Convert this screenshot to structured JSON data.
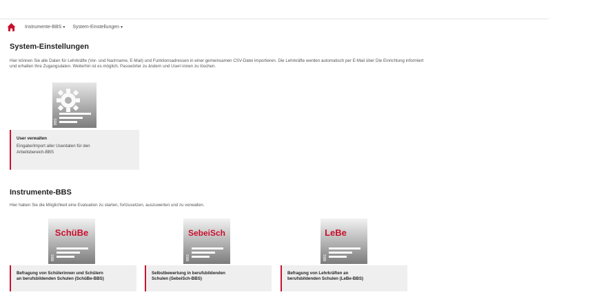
{
  "nav": {
    "items": [
      {
        "label": "Instrumente-BBS"
      },
      {
        "label": "System-Einstellungen"
      }
    ]
  },
  "colors": {
    "accent": "#c8102e",
    "card_bg": "#efefef"
  },
  "system": {
    "heading": "System-Einstellungen",
    "desc_line1": "Hier können Sie alle Daten für Lehrkräfte (Vor- und Nachname, E-Mail) und Funktionsadressen in einer gemeinsamen CSV-Datei importieren. Die Lehrkräfte werden automatisch per E-Mail über Die Einrichtung informiert",
    "desc_line2": "und erhalten Ihre Zugangsdaten. Weiterhin ist es möglich, Passwörter zu ändern und User/-innen zu löschen.",
    "card": {
      "icon_text": "BBS",
      "title": "User verwalten",
      "sub_line1": "Eingabe/Import aller Userdaten für den",
      "sub_line2": "Arbeitsbereich-BBS"
    }
  },
  "instruments": {
    "heading": "Instrumente-BBS",
    "desc": "Hier haben Sie die Möglichkeit eine Evaluation zu starten, fortzusetzen, auszuwerten und zu verwalten.",
    "cards": [
      {
        "logo": "SchüBe",
        "side": "BBS",
        "line1": "Befragung von Schülerinnen und Schülern",
        "line2": "an berufsbildenden Schulen (SchüBe-BBS)"
      },
      {
        "logo": "SebeiSch",
        "side": "BBS",
        "line1": "Selbstbewertung in berufsbildenden",
        "line2": "Schulen (SebeiSch-BBS)"
      },
      {
        "logo": "LeBe",
        "side": "BBS",
        "line1": "Befragung von Lehrkräften an",
        "line2": "berufsbildenden Schulen (LeBe-BBS)"
      }
    ]
  }
}
